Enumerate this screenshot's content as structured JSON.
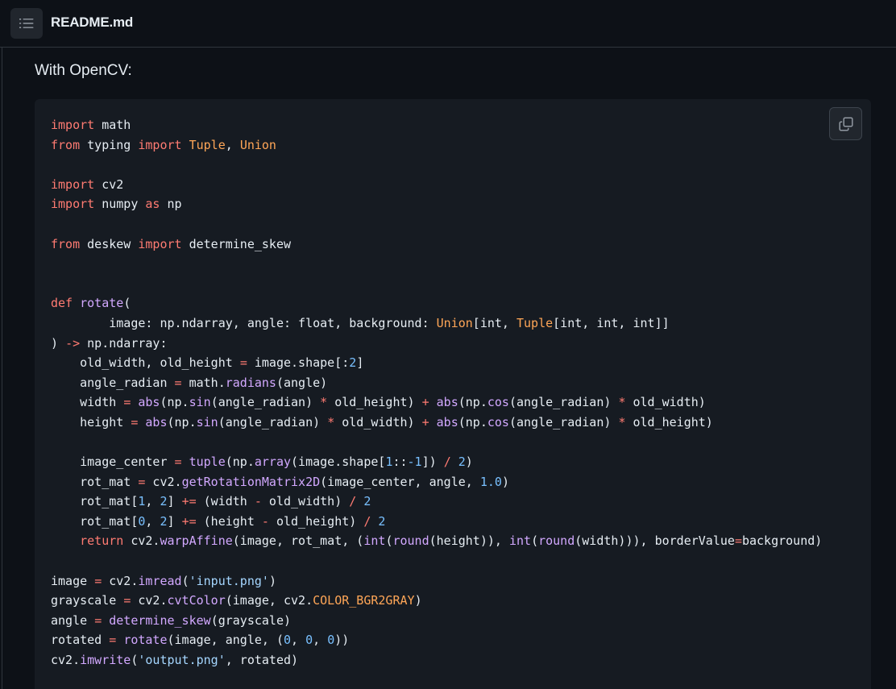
{
  "header": {
    "file_name": "README.md",
    "toc_icon": "list-unordered-icon"
  },
  "content": {
    "intro": "With OpenCV:"
  },
  "code_block": {
    "language": "python",
    "copy_icon": "copy-icon",
    "lines": [
      [
        {
          "t": "import",
          "c": "kw"
        },
        {
          "t": " math"
        }
      ],
      [
        {
          "t": "from",
          "c": "kw"
        },
        {
          "t": " typing "
        },
        {
          "t": "import",
          "c": "kw"
        },
        {
          "t": " "
        },
        {
          "t": "Tuple",
          "c": "cls"
        },
        {
          "t": ", "
        },
        {
          "t": "Union",
          "c": "cls"
        }
      ],
      [],
      [
        {
          "t": "import",
          "c": "kw"
        },
        {
          "t": " cv2"
        }
      ],
      [
        {
          "t": "import",
          "c": "kw"
        },
        {
          "t": " numpy "
        },
        {
          "t": "as",
          "c": "kw"
        },
        {
          "t": " np"
        }
      ],
      [],
      [
        {
          "t": "from",
          "c": "kw"
        },
        {
          "t": " deskew "
        },
        {
          "t": "import",
          "c": "kw"
        },
        {
          "t": " determine_skew"
        }
      ],
      [],
      [],
      [
        {
          "t": "def",
          "c": "kw"
        },
        {
          "t": " "
        },
        {
          "t": "rotate",
          "c": "fn"
        },
        {
          "t": "("
        }
      ],
      [
        {
          "t": "        image: np.ndarray, angle: float, background: "
        },
        {
          "t": "Union",
          "c": "cls"
        },
        {
          "t": "[int, "
        },
        {
          "t": "Tuple",
          "c": "cls"
        },
        {
          "t": "[int, int, int]]"
        }
      ],
      [
        {
          "t": ") "
        },
        {
          "t": "->",
          "c": "op"
        },
        {
          "t": " np.ndarray:"
        }
      ],
      [
        {
          "t": "    old_width, old_height "
        },
        {
          "t": "=",
          "c": "op"
        },
        {
          "t": " image.shape[:"
        },
        {
          "t": "2",
          "c": "num"
        },
        {
          "t": "]"
        }
      ],
      [
        {
          "t": "    angle_radian "
        },
        {
          "t": "=",
          "c": "op"
        },
        {
          "t": " math."
        },
        {
          "t": "radians",
          "c": "fn"
        },
        {
          "t": "(angle)"
        }
      ],
      [
        {
          "t": "    width "
        },
        {
          "t": "=",
          "c": "op"
        },
        {
          "t": " "
        },
        {
          "t": "abs",
          "c": "fn"
        },
        {
          "t": "(np."
        },
        {
          "t": "sin",
          "c": "fn"
        },
        {
          "t": "(angle_radian) "
        },
        {
          "t": "*",
          "c": "op"
        },
        {
          "t": " old_height) "
        },
        {
          "t": "+",
          "c": "op"
        },
        {
          "t": " "
        },
        {
          "t": "abs",
          "c": "fn"
        },
        {
          "t": "(np."
        },
        {
          "t": "cos",
          "c": "fn"
        },
        {
          "t": "(angle_radian) "
        },
        {
          "t": "*",
          "c": "op"
        },
        {
          "t": " old_width)"
        }
      ],
      [
        {
          "t": "    height "
        },
        {
          "t": "=",
          "c": "op"
        },
        {
          "t": " "
        },
        {
          "t": "abs",
          "c": "fn"
        },
        {
          "t": "(np."
        },
        {
          "t": "sin",
          "c": "fn"
        },
        {
          "t": "(angle_radian) "
        },
        {
          "t": "*",
          "c": "op"
        },
        {
          "t": " old_width) "
        },
        {
          "t": "+",
          "c": "op"
        },
        {
          "t": " "
        },
        {
          "t": "abs",
          "c": "fn"
        },
        {
          "t": "(np."
        },
        {
          "t": "cos",
          "c": "fn"
        },
        {
          "t": "(angle_radian) "
        },
        {
          "t": "*",
          "c": "op"
        },
        {
          "t": " old_height)"
        }
      ],
      [],
      [
        {
          "t": "    image_center "
        },
        {
          "t": "=",
          "c": "op"
        },
        {
          "t": " "
        },
        {
          "t": "tuple",
          "c": "fn"
        },
        {
          "t": "(np."
        },
        {
          "t": "array",
          "c": "fn"
        },
        {
          "t": "(image.shape["
        },
        {
          "t": "1",
          "c": "num"
        },
        {
          "t": "::"
        },
        {
          "t": "-1",
          "c": "num"
        },
        {
          "t": "]) "
        },
        {
          "t": "/",
          "c": "op"
        },
        {
          "t": " "
        },
        {
          "t": "2",
          "c": "num"
        },
        {
          "t": ")"
        }
      ],
      [
        {
          "t": "    rot_mat "
        },
        {
          "t": "=",
          "c": "op"
        },
        {
          "t": " cv2."
        },
        {
          "t": "getRotationMatrix2D",
          "c": "fn"
        },
        {
          "t": "(image_center, angle, "
        },
        {
          "t": "1.0",
          "c": "num"
        },
        {
          "t": ")"
        }
      ],
      [
        {
          "t": "    rot_mat["
        },
        {
          "t": "1",
          "c": "num"
        },
        {
          "t": ", "
        },
        {
          "t": "2",
          "c": "num"
        },
        {
          "t": "] "
        },
        {
          "t": "+=",
          "c": "op"
        },
        {
          "t": " (width "
        },
        {
          "t": "-",
          "c": "op"
        },
        {
          "t": " old_width) "
        },
        {
          "t": "/",
          "c": "op"
        },
        {
          "t": " "
        },
        {
          "t": "2",
          "c": "num"
        }
      ],
      [
        {
          "t": "    rot_mat["
        },
        {
          "t": "0",
          "c": "num"
        },
        {
          "t": ", "
        },
        {
          "t": "2",
          "c": "num"
        },
        {
          "t": "] "
        },
        {
          "t": "+=",
          "c": "op"
        },
        {
          "t": " (height "
        },
        {
          "t": "-",
          "c": "op"
        },
        {
          "t": " old_height) "
        },
        {
          "t": "/",
          "c": "op"
        },
        {
          "t": " "
        },
        {
          "t": "2",
          "c": "num"
        }
      ],
      [
        {
          "t": "    "
        },
        {
          "t": "return",
          "c": "kw"
        },
        {
          "t": " cv2."
        },
        {
          "t": "warpAffine",
          "c": "fn"
        },
        {
          "t": "(image, rot_mat, ("
        },
        {
          "t": "int",
          "c": "fn"
        },
        {
          "t": "("
        },
        {
          "t": "round",
          "c": "fn"
        },
        {
          "t": "(height)), "
        },
        {
          "t": "int",
          "c": "fn"
        },
        {
          "t": "("
        },
        {
          "t": "round",
          "c": "fn"
        },
        {
          "t": "(width))), borderValue"
        },
        {
          "t": "=",
          "c": "op"
        },
        {
          "t": "background)"
        }
      ],
      [],
      [
        {
          "t": "image "
        },
        {
          "t": "=",
          "c": "op"
        },
        {
          "t": " cv2."
        },
        {
          "t": "imread",
          "c": "fn"
        },
        {
          "t": "("
        },
        {
          "t": "'input.png'",
          "c": "str"
        },
        {
          "t": ")"
        }
      ],
      [
        {
          "t": "grayscale "
        },
        {
          "t": "=",
          "c": "op"
        },
        {
          "t": " cv2."
        },
        {
          "t": "cvtColor",
          "c": "fn"
        },
        {
          "t": "(image, cv2."
        },
        {
          "t": "COLOR_BGR2GRAY",
          "c": "cls"
        },
        {
          "t": ")"
        }
      ],
      [
        {
          "t": "angle "
        },
        {
          "t": "=",
          "c": "op"
        },
        {
          "t": " "
        },
        {
          "t": "determine_skew",
          "c": "fn"
        },
        {
          "t": "(grayscale)"
        }
      ],
      [
        {
          "t": "rotated "
        },
        {
          "t": "=",
          "c": "op"
        },
        {
          "t": " "
        },
        {
          "t": "rotate",
          "c": "fn"
        },
        {
          "t": "(image, angle, ("
        },
        {
          "t": "0",
          "c": "num"
        },
        {
          "t": ", "
        },
        {
          "t": "0",
          "c": "num"
        },
        {
          "t": ", "
        },
        {
          "t": "0",
          "c": "num"
        },
        {
          "t": "))"
        }
      ],
      [
        {
          "t": "cv2."
        },
        {
          "t": "imwrite",
          "c": "fn"
        },
        {
          "t": "("
        },
        {
          "t": "'output.png'",
          "c": "str"
        },
        {
          "t": ", rotated)"
        }
      ]
    ]
  },
  "colors": {
    "background": "#0d1117",
    "code_background": "#161b22",
    "border": "#30363d",
    "text": "#e6edf3",
    "keyword": "#ff7b72",
    "function": "#d2a8ff",
    "class_constant": "#ffa657",
    "number": "#79c0ff",
    "string": "#a5d6ff"
  }
}
